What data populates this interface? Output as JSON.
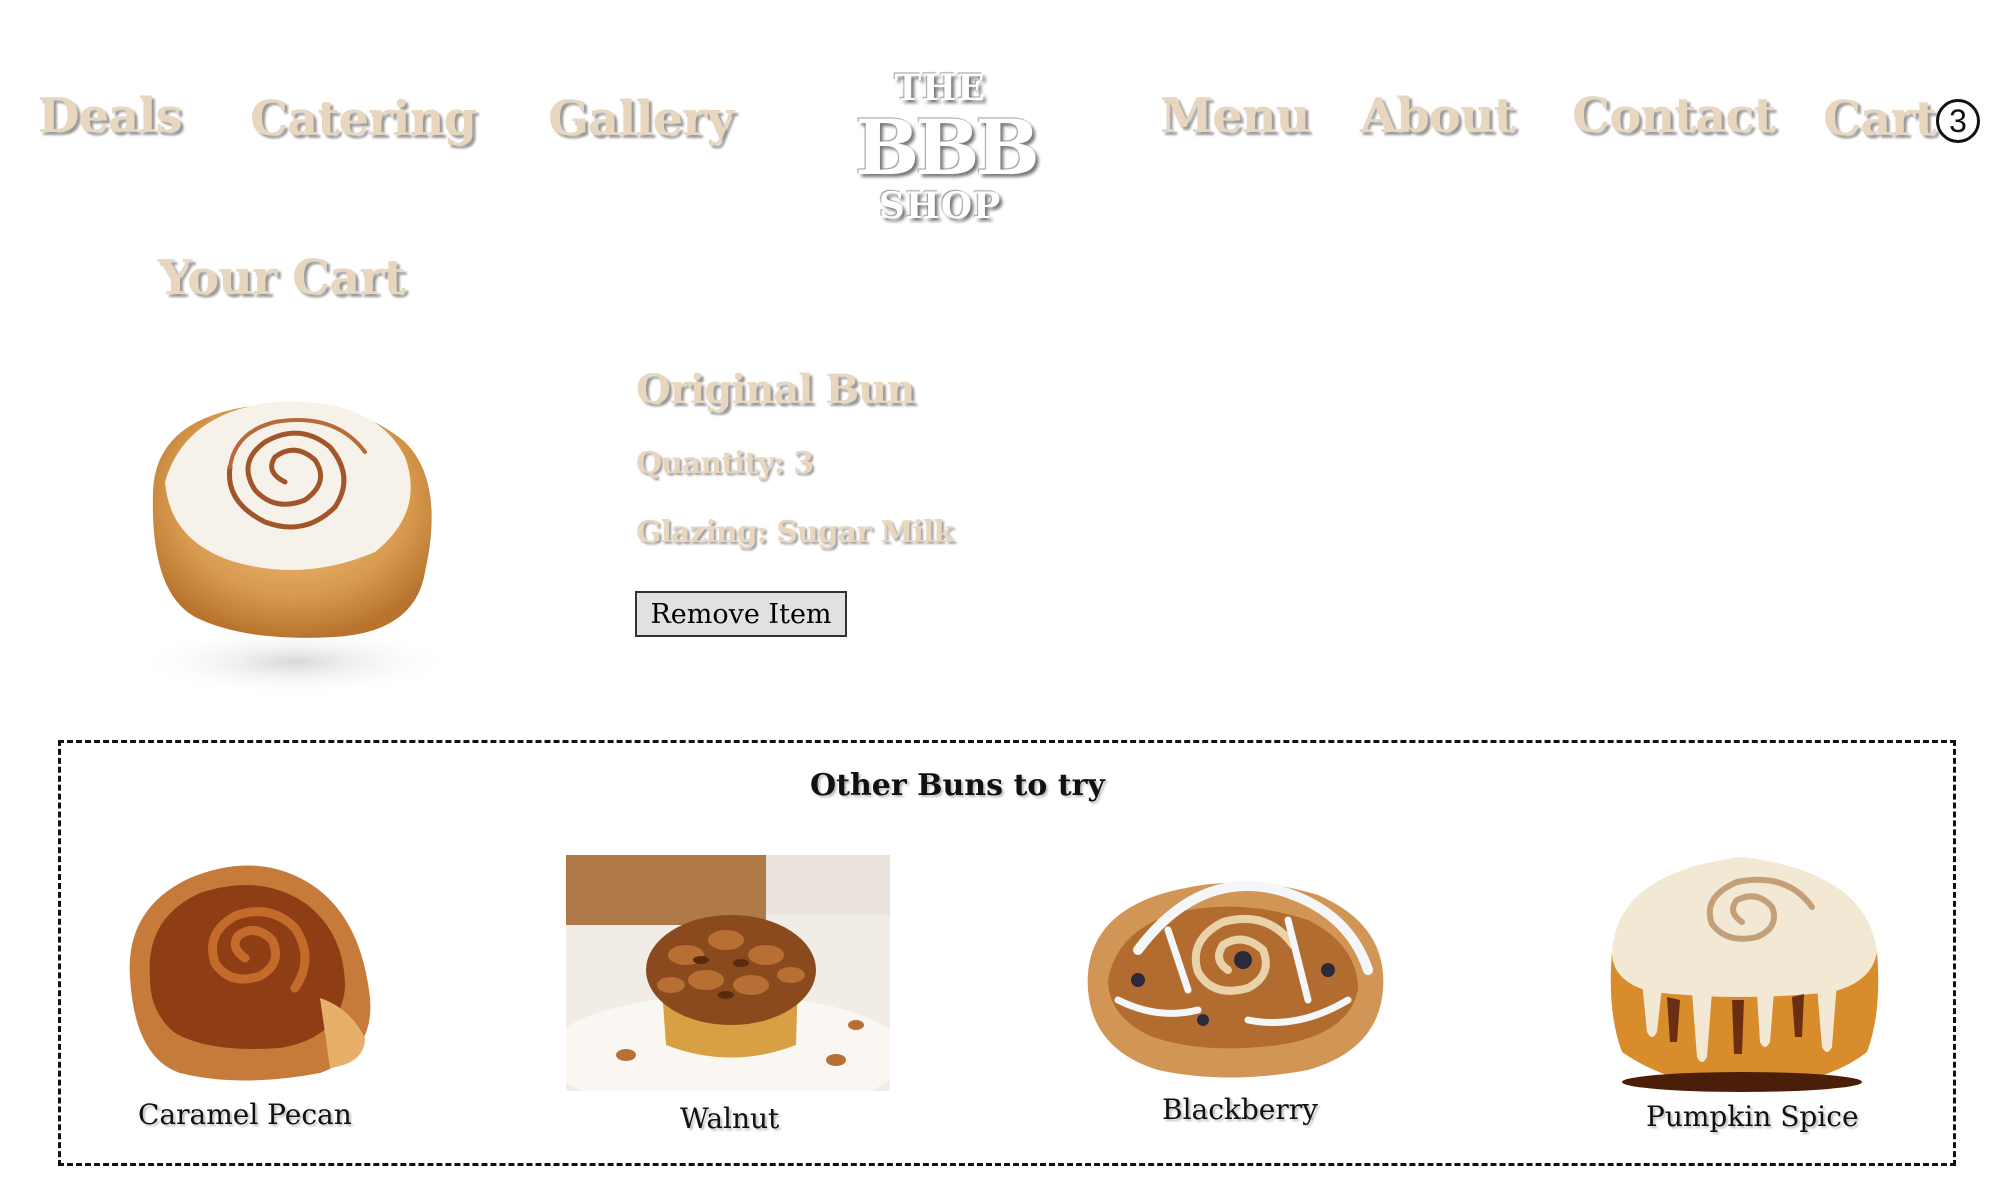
{
  "nav": {
    "left": [
      "Deals",
      "Catering",
      "Gallery"
    ],
    "right": [
      "Menu",
      "About",
      "Contact"
    ],
    "cart_label": "Cart",
    "cart_count": "③"
  },
  "logo": {
    "top": "THE",
    "middle": "BBB",
    "bottom": "SHOP"
  },
  "cart": {
    "heading": "Your Cart",
    "item": {
      "name": "Original Bun",
      "quantity_text": "Quantity: 3",
      "glazing_text": "Glazing: Sugar Milk",
      "remove_label": "Remove Item"
    }
  },
  "others": {
    "title": "Other Buns to try",
    "items": [
      {
        "label": "Caramel Pecan"
      },
      {
        "label": "Walnut"
      },
      {
        "label": "Blackberry"
      },
      {
        "label": "Pumpkin Spice"
      }
    ]
  },
  "colors": {
    "heading_tan": "#e8d6bf",
    "shadow_gray": "#9a9a9a"
  }
}
